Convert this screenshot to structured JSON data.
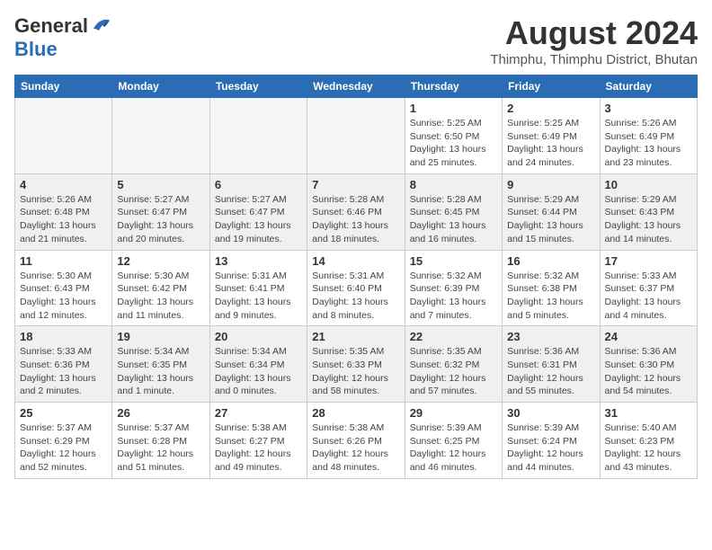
{
  "header": {
    "logo_line1": "General",
    "logo_line2": "Blue",
    "month_year": "August 2024",
    "location": "Thimphu, Thimphu District, Bhutan"
  },
  "weekdays": [
    "Sunday",
    "Monday",
    "Tuesday",
    "Wednesday",
    "Thursday",
    "Friday",
    "Saturday"
  ],
  "weeks": [
    [
      {
        "day": "",
        "info": "",
        "empty": true
      },
      {
        "day": "",
        "info": "",
        "empty": true
      },
      {
        "day": "",
        "info": "",
        "empty": true
      },
      {
        "day": "",
        "info": "",
        "empty": true
      },
      {
        "day": "1",
        "info": "Sunrise: 5:25 AM\nSunset: 6:50 PM\nDaylight: 13 hours\nand 25 minutes.",
        "empty": false
      },
      {
        "day": "2",
        "info": "Sunrise: 5:25 AM\nSunset: 6:49 PM\nDaylight: 13 hours\nand 24 minutes.",
        "empty": false
      },
      {
        "day": "3",
        "info": "Sunrise: 5:26 AM\nSunset: 6:49 PM\nDaylight: 13 hours\nand 23 minutes.",
        "empty": false
      }
    ],
    [
      {
        "day": "4",
        "info": "Sunrise: 5:26 AM\nSunset: 6:48 PM\nDaylight: 13 hours\nand 21 minutes.",
        "empty": false
      },
      {
        "day": "5",
        "info": "Sunrise: 5:27 AM\nSunset: 6:47 PM\nDaylight: 13 hours\nand 20 minutes.",
        "empty": false
      },
      {
        "day": "6",
        "info": "Sunrise: 5:27 AM\nSunset: 6:47 PM\nDaylight: 13 hours\nand 19 minutes.",
        "empty": false
      },
      {
        "day": "7",
        "info": "Sunrise: 5:28 AM\nSunset: 6:46 PM\nDaylight: 13 hours\nand 18 minutes.",
        "empty": false
      },
      {
        "day": "8",
        "info": "Sunrise: 5:28 AM\nSunset: 6:45 PM\nDaylight: 13 hours\nand 16 minutes.",
        "empty": false
      },
      {
        "day": "9",
        "info": "Sunrise: 5:29 AM\nSunset: 6:44 PM\nDaylight: 13 hours\nand 15 minutes.",
        "empty": false
      },
      {
        "day": "10",
        "info": "Sunrise: 5:29 AM\nSunset: 6:43 PM\nDaylight: 13 hours\nand 14 minutes.",
        "empty": false
      }
    ],
    [
      {
        "day": "11",
        "info": "Sunrise: 5:30 AM\nSunset: 6:43 PM\nDaylight: 13 hours\nand 12 minutes.",
        "empty": false
      },
      {
        "day": "12",
        "info": "Sunrise: 5:30 AM\nSunset: 6:42 PM\nDaylight: 13 hours\nand 11 minutes.",
        "empty": false
      },
      {
        "day": "13",
        "info": "Sunrise: 5:31 AM\nSunset: 6:41 PM\nDaylight: 13 hours\nand 9 minutes.",
        "empty": false
      },
      {
        "day": "14",
        "info": "Sunrise: 5:31 AM\nSunset: 6:40 PM\nDaylight: 13 hours\nand 8 minutes.",
        "empty": false
      },
      {
        "day": "15",
        "info": "Sunrise: 5:32 AM\nSunset: 6:39 PM\nDaylight: 13 hours\nand 7 minutes.",
        "empty": false
      },
      {
        "day": "16",
        "info": "Sunrise: 5:32 AM\nSunset: 6:38 PM\nDaylight: 13 hours\nand 5 minutes.",
        "empty": false
      },
      {
        "day": "17",
        "info": "Sunrise: 5:33 AM\nSunset: 6:37 PM\nDaylight: 13 hours\nand 4 minutes.",
        "empty": false
      }
    ],
    [
      {
        "day": "18",
        "info": "Sunrise: 5:33 AM\nSunset: 6:36 PM\nDaylight: 13 hours\nand 2 minutes.",
        "empty": false
      },
      {
        "day": "19",
        "info": "Sunrise: 5:34 AM\nSunset: 6:35 PM\nDaylight: 13 hours\nand 1 minute.",
        "empty": false
      },
      {
        "day": "20",
        "info": "Sunrise: 5:34 AM\nSunset: 6:34 PM\nDaylight: 13 hours\nand 0 minutes.",
        "empty": false
      },
      {
        "day": "21",
        "info": "Sunrise: 5:35 AM\nSunset: 6:33 PM\nDaylight: 12 hours\nand 58 minutes.",
        "empty": false
      },
      {
        "day": "22",
        "info": "Sunrise: 5:35 AM\nSunset: 6:32 PM\nDaylight: 12 hours\nand 57 minutes.",
        "empty": false
      },
      {
        "day": "23",
        "info": "Sunrise: 5:36 AM\nSunset: 6:31 PM\nDaylight: 12 hours\nand 55 minutes.",
        "empty": false
      },
      {
        "day": "24",
        "info": "Sunrise: 5:36 AM\nSunset: 6:30 PM\nDaylight: 12 hours\nand 54 minutes.",
        "empty": false
      }
    ],
    [
      {
        "day": "25",
        "info": "Sunrise: 5:37 AM\nSunset: 6:29 PM\nDaylight: 12 hours\nand 52 minutes.",
        "empty": false
      },
      {
        "day": "26",
        "info": "Sunrise: 5:37 AM\nSunset: 6:28 PM\nDaylight: 12 hours\nand 51 minutes.",
        "empty": false
      },
      {
        "day": "27",
        "info": "Sunrise: 5:38 AM\nSunset: 6:27 PM\nDaylight: 12 hours\nand 49 minutes.",
        "empty": false
      },
      {
        "day": "28",
        "info": "Sunrise: 5:38 AM\nSunset: 6:26 PM\nDaylight: 12 hours\nand 48 minutes.",
        "empty": false
      },
      {
        "day": "29",
        "info": "Sunrise: 5:39 AM\nSunset: 6:25 PM\nDaylight: 12 hours\nand 46 minutes.",
        "empty": false
      },
      {
        "day": "30",
        "info": "Sunrise: 5:39 AM\nSunset: 6:24 PM\nDaylight: 12 hours\nand 44 minutes.",
        "empty": false
      },
      {
        "day": "31",
        "info": "Sunrise: 5:40 AM\nSunset: 6:23 PM\nDaylight: 12 hours\nand 43 minutes.",
        "empty": false
      }
    ]
  ]
}
